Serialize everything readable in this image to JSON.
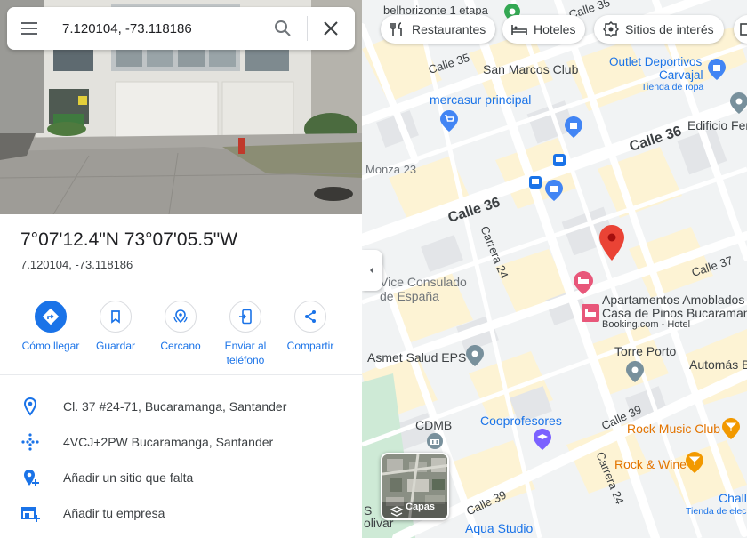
{
  "search": {
    "value": "7.120104, -73.118186"
  },
  "place": {
    "title": "7°07'12.4\"N 73°07'05.5\"W",
    "subtitle": "7.120104, -73.118186"
  },
  "actions": [
    {
      "label": "Cómo llegar",
      "icon": "directions-icon"
    },
    {
      "label": "Guardar",
      "icon": "bookmark-icon"
    },
    {
      "label": "Cercano",
      "icon": "nearby-icon"
    },
    {
      "label": "Enviar al teléfono",
      "icon": "send-to-phone-icon"
    },
    {
      "label": "Compartir",
      "icon": "share-icon"
    }
  ],
  "info": [
    {
      "text": "Cl. 37 #24-71, Bucaramanga, Santander",
      "icon": "location-pin-icon"
    },
    {
      "text": "4VCJ+2PW Bucaramanga, Santander",
      "icon": "plus-code-icon"
    },
    {
      "text": "Añadir un sitio que falta",
      "icon": "add-place-icon"
    },
    {
      "text": "Añadir tu empresa",
      "icon": "add-business-icon"
    }
  ],
  "chips": [
    {
      "label": "Restaurantes",
      "icon": "restaurant-icon"
    },
    {
      "label": "Hoteles",
      "icon": "hotel-icon"
    },
    {
      "label": "Sitios de interés",
      "icon": "attraction-icon"
    }
  ],
  "map": {
    "layers_label": "Capas",
    "streets": {
      "calle35": "Calle 35",
      "calle36a": "Calle 36",
      "calle36b": "Calle 36",
      "calle37": "Calle 37",
      "calle39a": "Calle 39",
      "calle39b": "Calle 39",
      "carrera24a": "Carrera 24",
      "carrera24b": "Carrera 24",
      "top_street": "Calle 35"
    },
    "places": {
      "belhorizonte": "belhorizonte 1 etapa",
      "san_marcos": "San Marcos Club",
      "outlet1": "Outlet Deportivos",
      "outlet2": "Carvajal",
      "outlet_sub": "Tienda de ropa",
      "mercasur": "mercasur principal",
      "edificio": "Edificio Fen",
      "monza": "Monza 23",
      "vice1": "Vice Consulado",
      "vice2": "de España",
      "apart1": "Apartamentos Amoblados",
      "apart2": "Casa de Pinos Bucaraman",
      "apart_sub": "Booking.com - Hotel",
      "asmet": "Asmet Salud EPS",
      "torre": "Torre Porto",
      "automas": "Automás B",
      "cdmb": "CDMB",
      "coopro": "Cooprofesores",
      "rockmusic": "Rock Music Club",
      "rockwine": "Rock & Wine",
      "chall": "Chall",
      "chall_sub": "Tienda de elec",
      "aqua": "Aqua Studio",
      "bolivar1": "S",
      "bolivar2": "olivar"
    },
    "colors": {
      "road": "#ffffff",
      "block": "#f8f9fa",
      "building": "#e8eaed",
      "yellow_block": "#fdf3d4",
      "park": "#ceead6",
      "poi_blue": "#4285f4",
      "poi_purple": "#7b61ff",
      "poi_orange": "#f29900",
      "hotel_pink": "#e8577a",
      "pin_red": "#ea4335"
    }
  }
}
